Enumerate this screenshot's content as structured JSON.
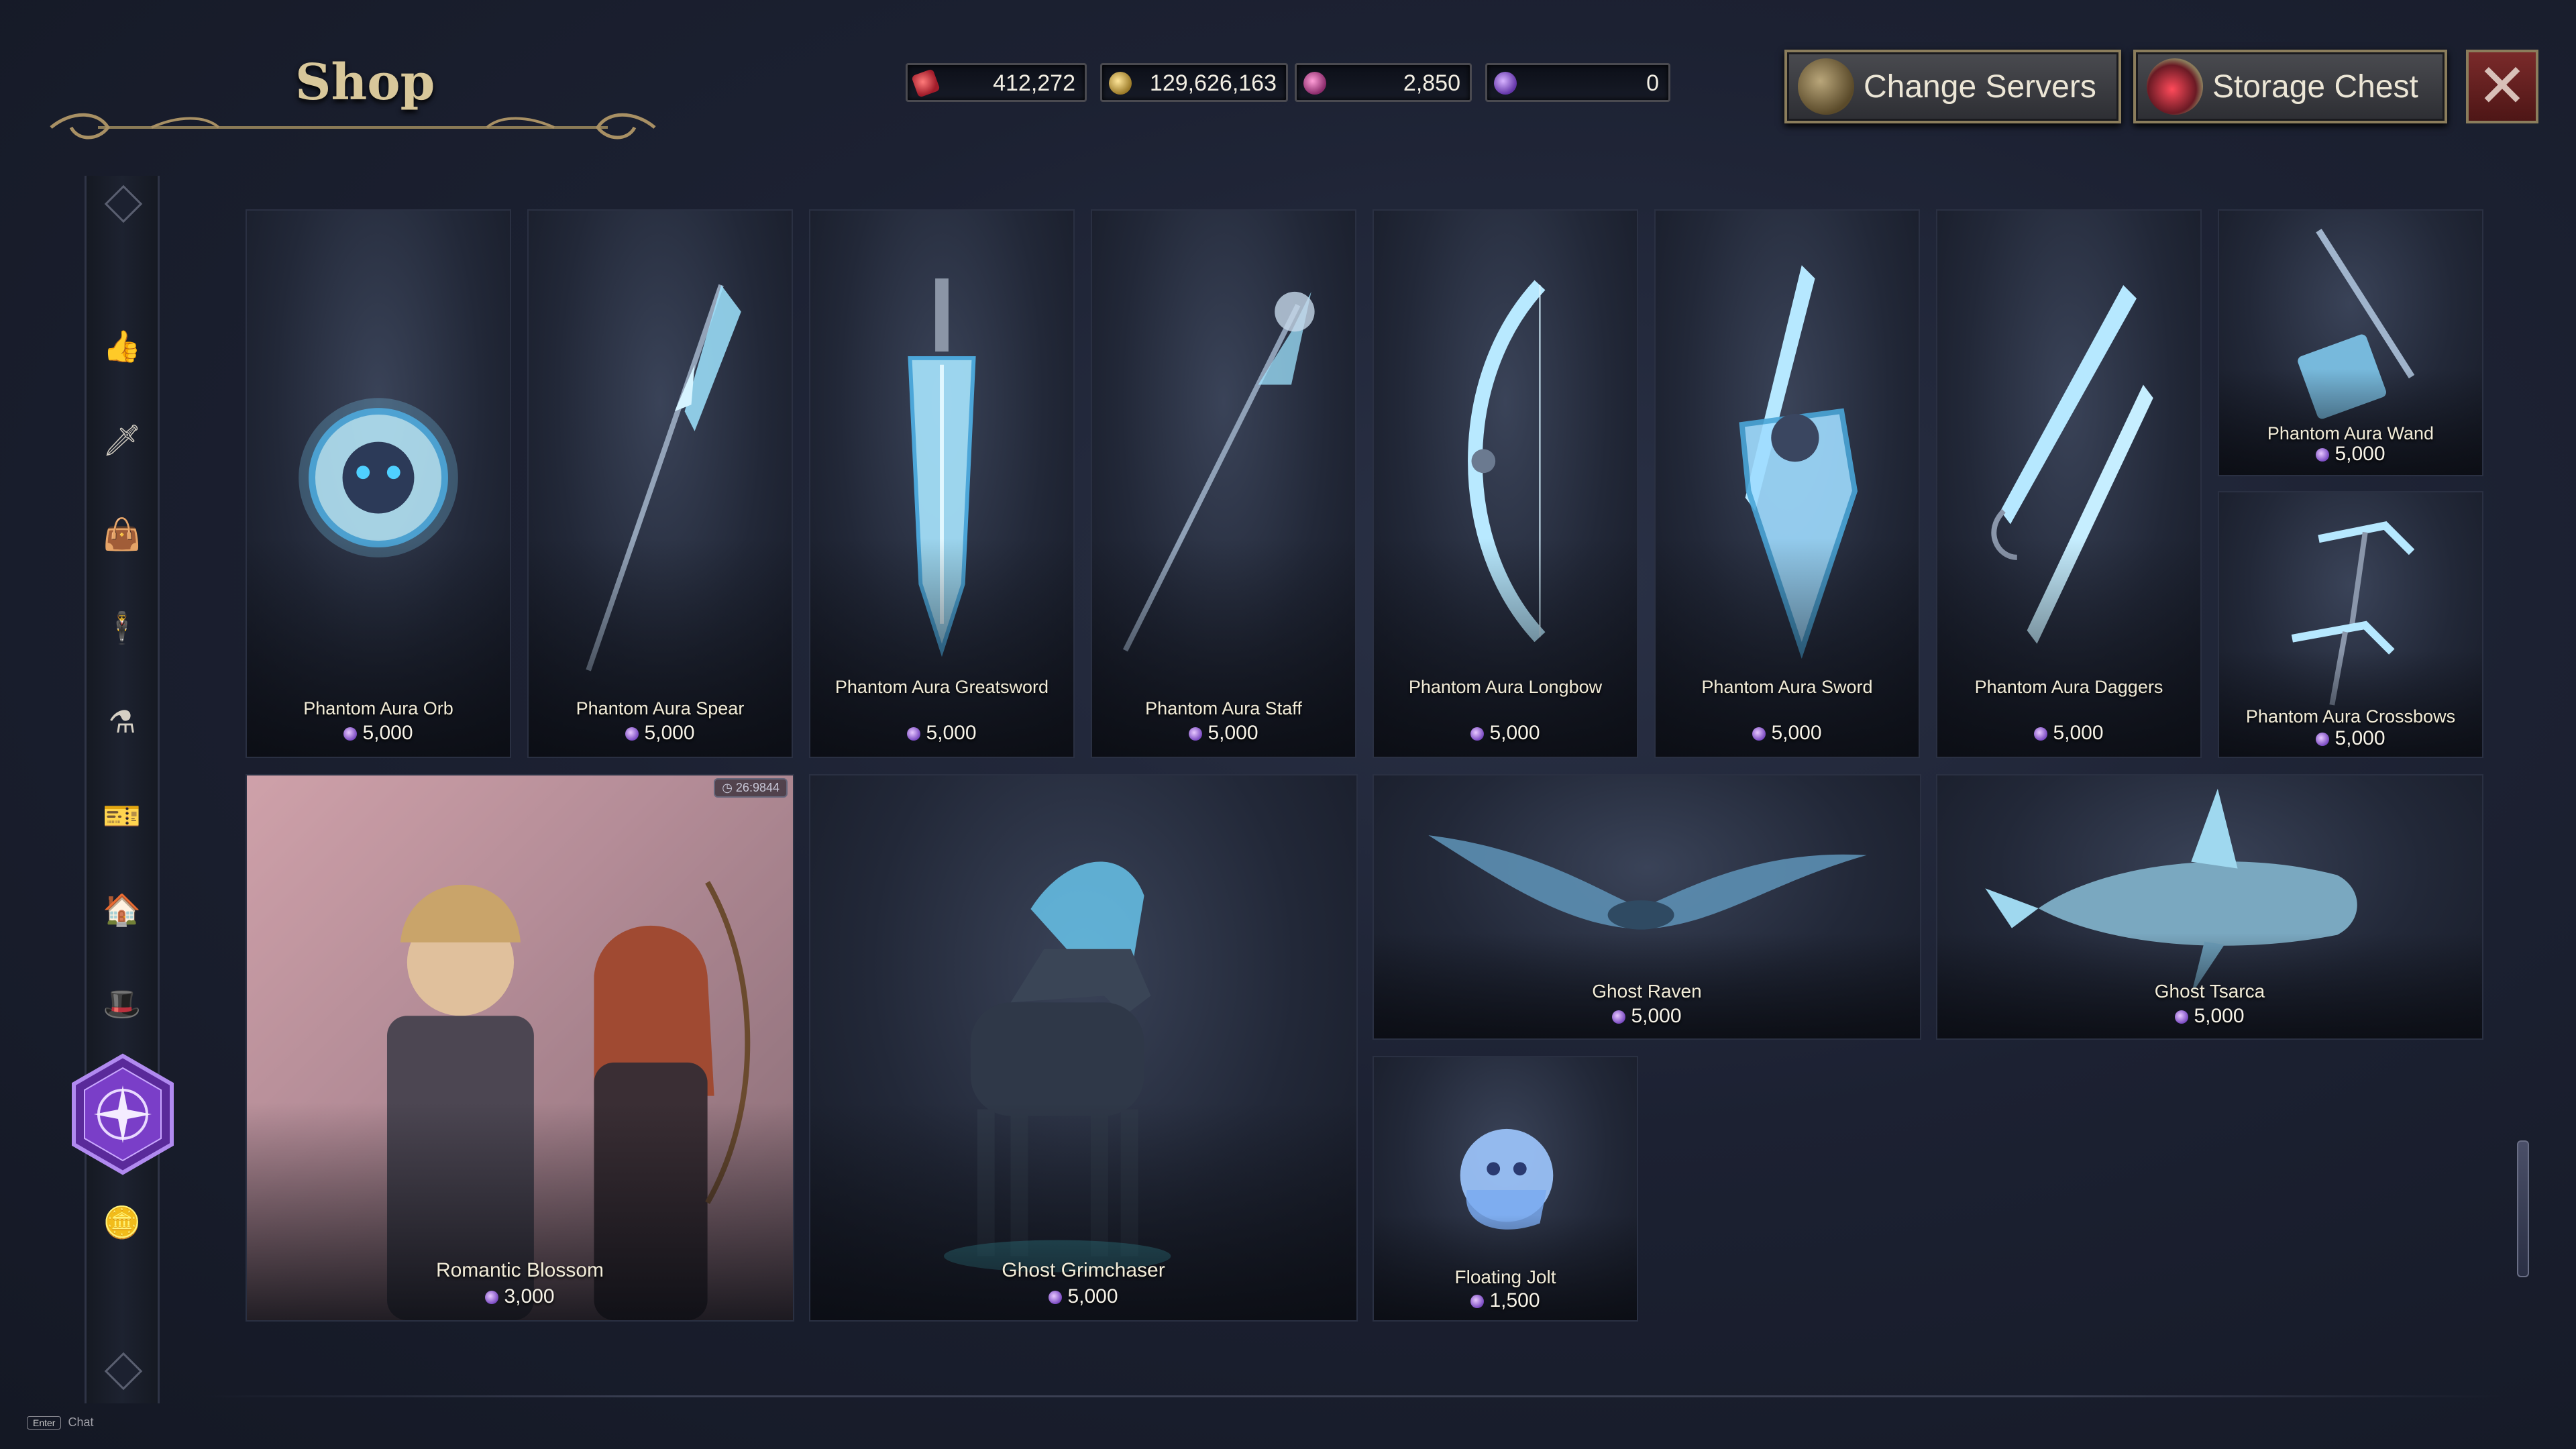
{
  "header": {
    "title": "Shop"
  },
  "currencies": [
    {
      "id": "ruby",
      "value": "412,272",
      "icon": "ruby-currency-icon"
    },
    {
      "id": "gold",
      "value": "129,626,163",
      "icon": "gold-coin-icon"
    },
    {
      "id": "pink",
      "value": "2,850",
      "icon": "pink-gem-icon"
    },
    {
      "id": "star",
      "value": "0",
      "icon": "star-coin-icon"
    }
  ],
  "buttons": {
    "change_servers": "Change Servers",
    "storage_chest": "Storage Chest"
  },
  "sidebar": {
    "items": [
      {
        "icon": "thumbs-up-icon"
      },
      {
        "icon": "sword-icon"
      },
      {
        "icon": "bag-icon"
      },
      {
        "icon": "character-icon"
      },
      {
        "icon": "potion-icon"
      },
      {
        "icon": "ticket-icon"
      },
      {
        "icon": "house-icon"
      },
      {
        "icon": "hat-icon"
      },
      {
        "icon": "compass-icon"
      },
      {
        "icon": "coins-icon"
      }
    ]
  },
  "items": [
    {
      "name": "Phantom Aura Orb",
      "price": "5,000"
    },
    {
      "name": "Phantom Aura Spear",
      "price": "5,000"
    },
    {
      "name": "Phantom Aura Greatsword",
      "price": "5,000"
    },
    {
      "name": "Phantom Aura Staff",
      "price": "5,000"
    },
    {
      "name": "Phantom Aura Longbow",
      "price": "5,000"
    },
    {
      "name": "Phantom Aura Sword",
      "price": "5,000"
    },
    {
      "name": "Phantom Aura Daggers",
      "price": "5,000"
    },
    {
      "name": "Phantom Aura Wand",
      "price": "5,000"
    },
    {
      "name": "Phantom Aura Crossbows",
      "price": "5,000"
    },
    {
      "name": "Romantic Blossom",
      "price": "3,000",
      "badge": "26:9844"
    },
    {
      "name": "Ghost Grimchaser",
      "price": "5,000"
    },
    {
      "name": "Ghost Raven",
      "price": "5,000"
    },
    {
      "name": "Ghost Tsarca",
      "price": "5,000"
    },
    {
      "name": "Floating Jolt",
      "price": "1,500"
    }
  ],
  "footer": {
    "key": "Enter",
    "chat": "Chat"
  },
  "colors": {
    "accent_gold": "#d8c79a",
    "price_coin": "#9a6ae0",
    "close_red": "#7a2a2a"
  }
}
